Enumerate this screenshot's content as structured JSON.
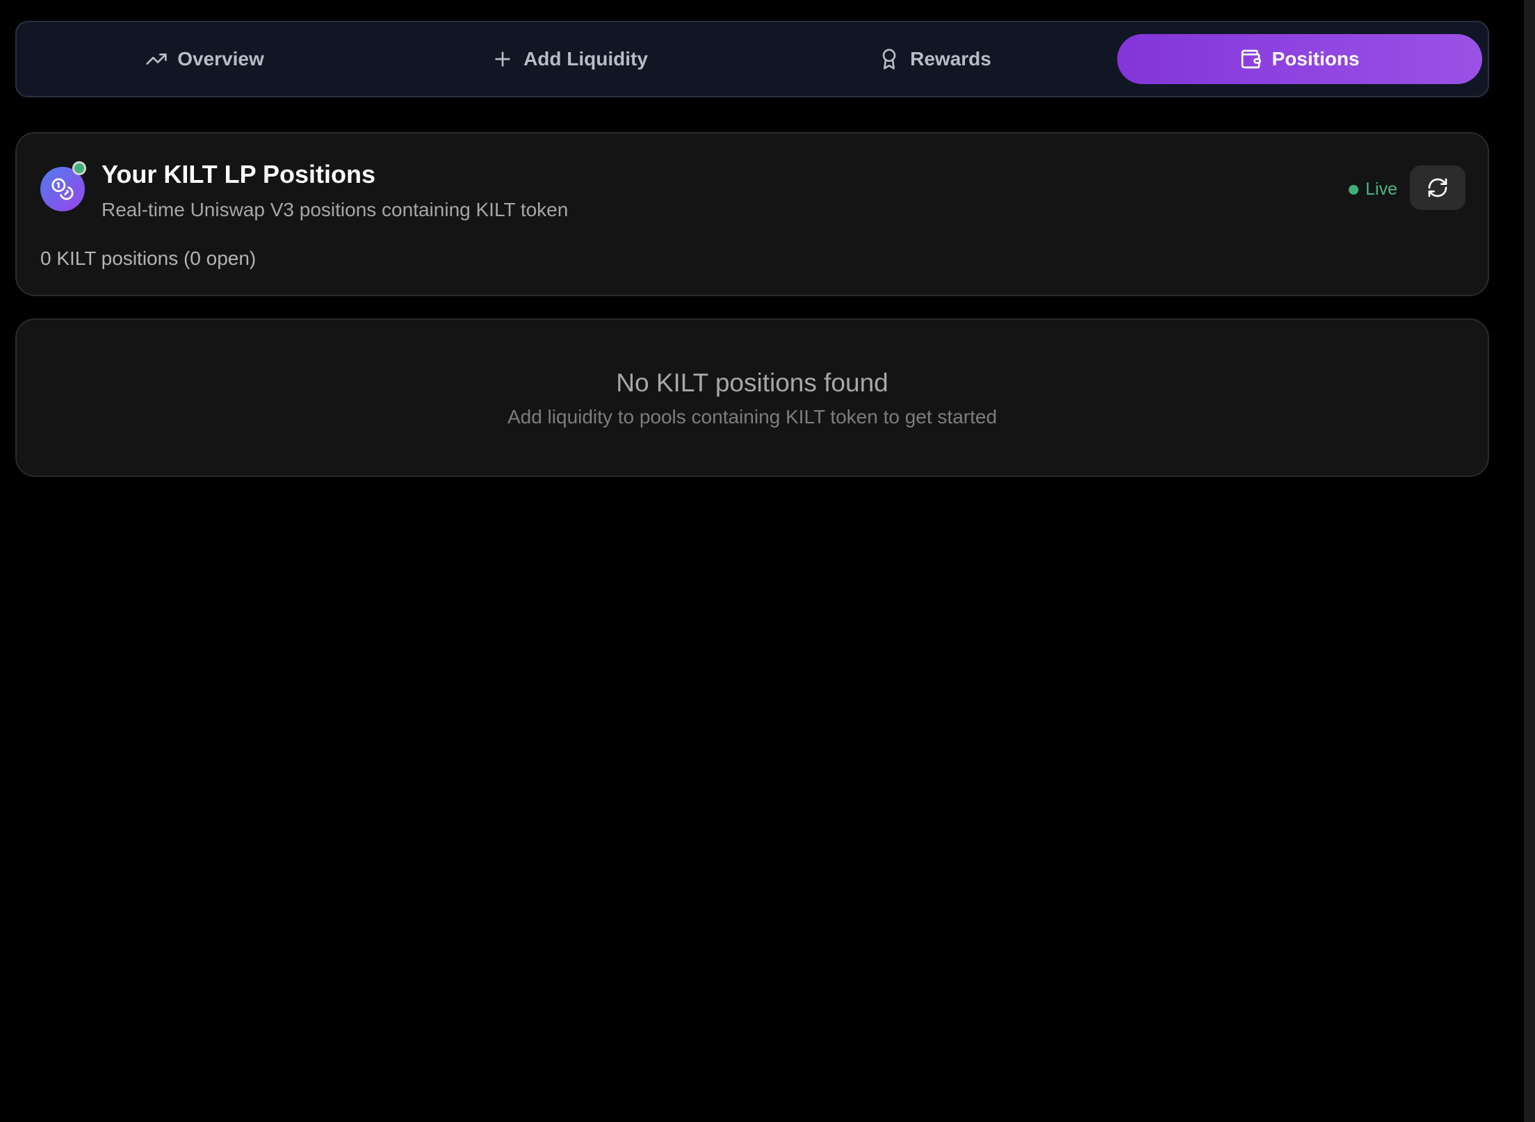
{
  "tabs": [
    {
      "label": "Overview",
      "icon": "trending-up-icon",
      "active": false
    },
    {
      "label": "Add Liquidity",
      "icon": "plus-icon",
      "active": false
    },
    {
      "label": "Rewards",
      "icon": "award-icon",
      "active": false
    },
    {
      "label": "Positions",
      "icon": "wallet-icon",
      "active": true
    }
  ],
  "positions": {
    "title": "Your KILT LP Positions",
    "subtitle": "Real-time Uniswap V3 positions containing KILT token",
    "count_text": "0 KILT positions (0 open)",
    "status_label": "Live",
    "avatar_icon": "coins-icon",
    "refresh_icon": "refresh-icon"
  },
  "empty_state": {
    "title": "No KILT positions found",
    "message": "Add liquidity to pools containing KILT token to get started"
  },
  "colors": {
    "accent": "#8b3ddf",
    "live": "#3fae7a",
    "background": "#000000",
    "card": "#141414"
  }
}
